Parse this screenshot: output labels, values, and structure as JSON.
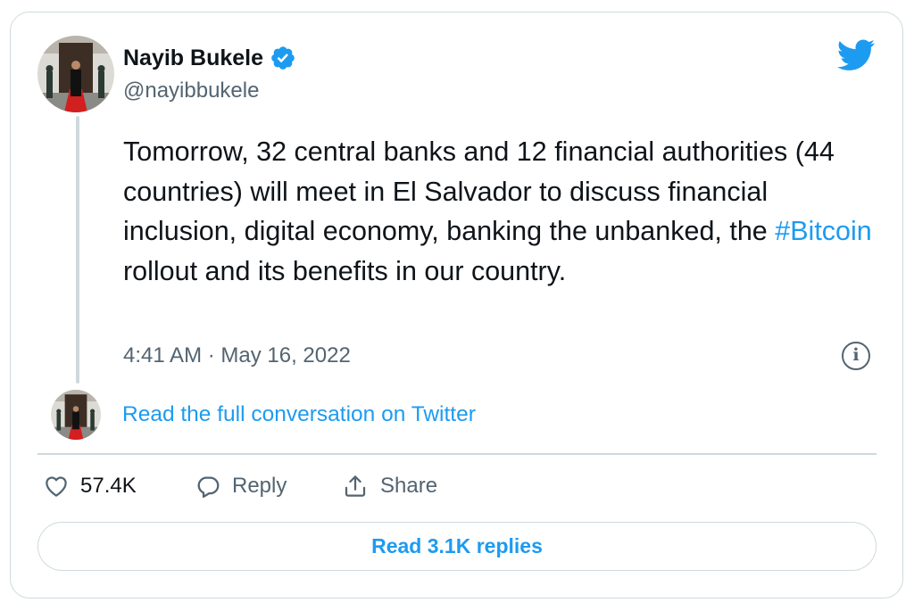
{
  "author": {
    "name": "Nayib Bukele",
    "handle": "@nayibbukele",
    "verified": true,
    "avatar_icon": "profile-photo"
  },
  "tweet": {
    "text_before_hashtag": "Tomorrow, 32 central banks and 12 financial authorities (44 countries) will meet in El Salvador to discuss financial inclusion, digital economy, banking the unbanked, the ",
    "hashtag": "#Bitcoin",
    "text_after_hashtag": " rollout and its benefits in our country.",
    "timestamp": "4:41 AM · May 16, 2022"
  },
  "conversation": {
    "read_full_label": "Read the full conversation on Twitter"
  },
  "actions": {
    "like_count": "57.4K",
    "reply_label": "Reply",
    "share_label": "Share"
  },
  "footer": {
    "read_replies_label": "Read 3.1K replies"
  },
  "icons": {
    "brand": "twitter-bird-icon",
    "verified": "verified-badge-icon",
    "info": "info-icon",
    "like": "heart-icon",
    "reply": "reply-bubble-icon",
    "share": "share-icon"
  },
  "colors": {
    "accent": "#1d9bf0",
    "text": "#0f1419",
    "secondary": "#536471",
    "border": "#cfd9de"
  }
}
